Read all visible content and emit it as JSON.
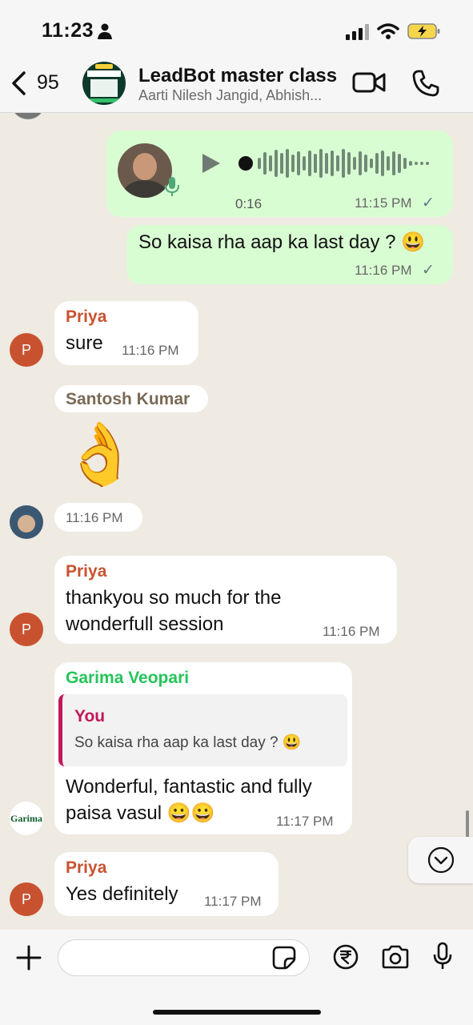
{
  "status_bar": {
    "time": "11:23"
  },
  "header": {
    "back_count": "95",
    "title": "LeadBot master class",
    "subtitle": "Aarti Nilesh Jangid, Abhish..."
  },
  "messages": {
    "voice": {
      "duration": "0:16",
      "time": "11:15 PM",
      "tick": "✓"
    },
    "out1": {
      "text": "So kaisa rha aap ka last day ? 😃",
      "time": "11:16 PM",
      "tick": "✓"
    },
    "priya1": {
      "sender": "Priya",
      "text": "sure",
      "time": "11:16 PM",
      "initial": "P"
    },
    "santosh": {
      "sender": "Santosh Kumar",
      "emoji": "👌",
      "time": "11:16 PM"
    },
    "priya2": {
      "sender": "Priya",
      "line1": "thankyou so much for the",
      "line2": "wonderfull session",
      "time": "11:16 PM",
      "initial": "P"
    },
    "garima": {
      "sender": "Garima Veopari",
      "quote_author": "You",
      "quote_text": "So kaisa rha aap ka last day ? 😃",
      "line1": "Wonderful, fantastic and fully",
      "line2": "paisa vasul 😀😀",
      "time": "11:17 PM",
      "avatar_text": "Garima"
    },
    "priya3": {
      "sender": "Priya",
      "text": "Yes definitely",
      "time": "11:17 PM",
      "initial": "P"
    }
  },
  "colors": {
    "outgoing": "#d9fdd3",
    "incoming": "#ffffff",
    "priya": "#c8522f",
    "santosh": "#7a6a55",
    "garima": "#25c45a",
    "quote_author": "#c2185b"
  }
}
